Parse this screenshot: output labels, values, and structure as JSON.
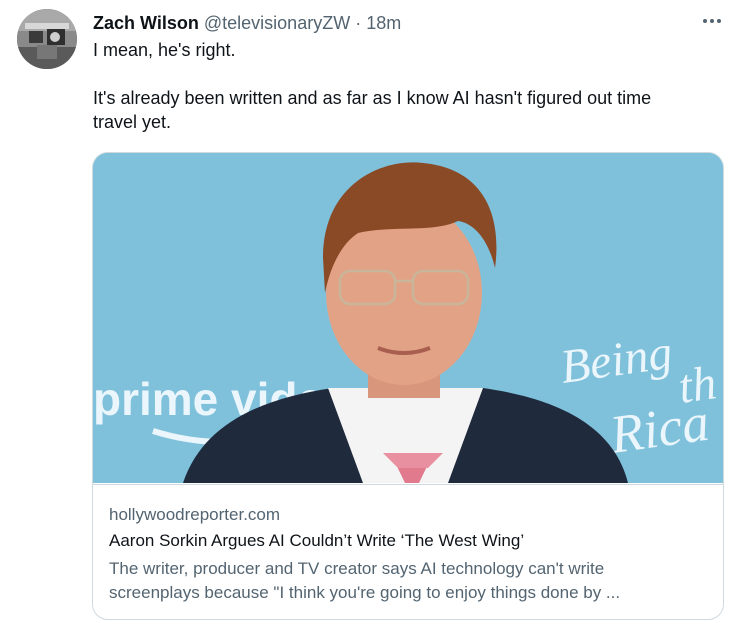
{
  "tweet": {
    "author_name": "Zach Wilson",
    "handle": "@televisionaryZW",
    "separator": "·",
    "time": "18m",
    "text_line1": "I mean, he's right.",
    "text_line2": "It's already been written and as far as I know AI hasn't figured out time",
    "text_line3": "travel yet."
  },
  "card": {
    "image_text_left": "prime vide",
    "image_text_right_1": "Being",
    "image_text_right_2": "th",
    "image_text_right_3": "Rica",
    "domain": "hollywoodreporter.com",
    "title": "Aaron Sorkin Argues AI Couldn’t Write ‘The West Wing’",
    "description_line1": "The writer, producer and TV creator says AI technology can't write",
    "description_line2": "screenplays because \"I think you're going to enjoy things done by ..."
  },
  "icons": {
    "more": "more-options-icon"
  },
  "colors": {
    "text_primary": "#0f1419",
    "text_secondary": "#536471",
    "border": "#cfd9de",
    "image_background": "#7fc0db"
  }
}
